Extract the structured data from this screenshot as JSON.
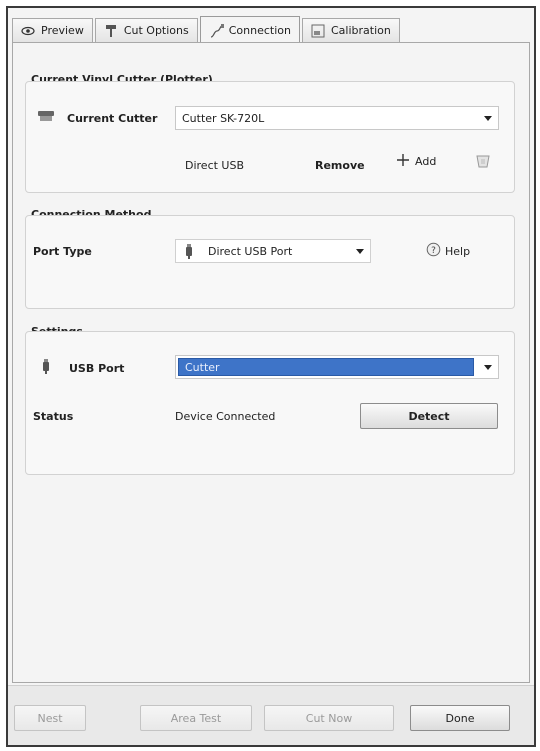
{
  "tabs": [
    {
      "label": "Preview",
      "icon": "eye-icon",
      "active": false
    },
    {
      "label": "Cut Options",
      "icon": "blade-icon",
      "active": false
    },
    {
      "label": "Connection",
      "icon": "cable-icon",
      "active": true
    },
    {
      "label": "Calibration",
      "icon": "calibration-icon",
      "active": false
    }
  ],
  "current_cutter_section": {
    "title": "Current Vinyl Cutter (Plotter)",
    "cutter_label": "Current Cutter",
    "cutter_value": "Cutter SK-720L",
    "connection_text": "Direct USB",
    "remove_label": "Remove",
    "add_label": "Add"
  },
  "connection_method": {
    "title": "Connection Method",
    "port_type_label": "Port Type",
    "port_type_value": "Direct USB Port",
    "help_label": "Help"
  },
  "settings": {
    "title": "Settings",
    "usb_port_label": "USB Port",
    "usb_port_value": "Cutter",
    "status_label": "Status",
    "status_value": "Device Connected",
    "detect_label": "Detect"
  },
  "footer": {
    "nest_label": "Nest",
    "area_test_label": "Area Test",
    "cut_now_label": "Cut Now",
    "done_label": "Done"
  },
  "colors": {
    "selection": "#3e74c8"
  }
}
